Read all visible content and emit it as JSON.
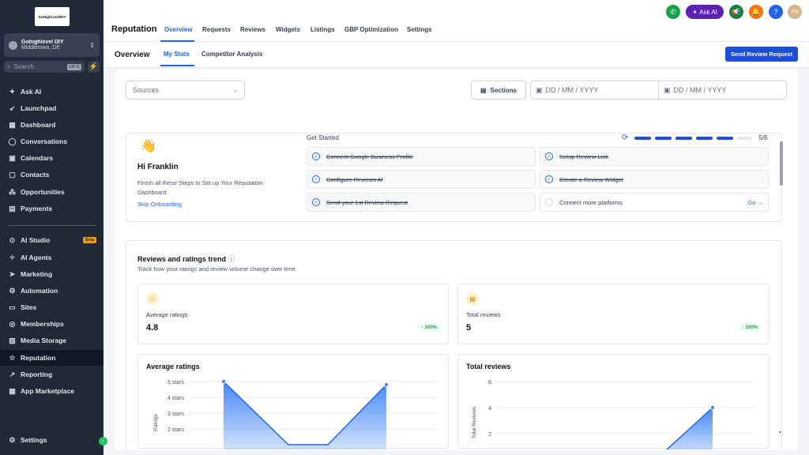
{
  "sidebar": {
    "logo_text": "GoHighLevelDIY",
    "account": {
      "name": "Gohighlevel DIY",
      "location": "Middletown, DE"
    },
    "search": {
      "placeholder": "Search",
      "shortcut": "ctrl K"
    },
    "items": [
      {
        "label": "Ask AI",
        "icon": "sparkle-icon"
      },
      {
        "label": "Launchpad",
        "icon": "rocket-icon"
      },
      {
        "label": "Dashboard",
        "icon": "dashboard-icon"
      },
      {
        "label": "Conversations",
        "icon": "chat-icon"
      },
      {
        "label": "Calendars",
        "icon": "calendar-icon"
      },
      {
        "label": "Contacts",
        "icon": "contacts-icon"
      },
      {
        "label": "Opportunities",
        "icon": "opportunities-icon"
      },
      {
        "label": "Payments",
        "icon": "payments-icon"
      },
      {
        "label": "AI Studio",
        "icon": "ai-studio-icon",
        "badge": "Beta"
      },
      {
        "label": "AI Agents",
        "icon": "ai-agents-icon"
      },
      {
        "label": "Marketing",
        "icon": "marketing-icon"
      },
      {
        "label": "Automation",
        "icon": "automation-icon"
      },
      {
        "label": "Sites",
        "icon": "sites-icon"
      },
      {
        "label": "Memberships",
        "icon": "memberships-icon"
      },
      {
        "label": "Media Storage",
        "icon": "media-icon"
      },
      {
        "label": "Reputation",
        "icon": "star-icon"
      },
      {
        "label": "Reporting",
        "icon": "reporting-icon"
      },
      {
        "label": "App Marketplace",
        "icon": "apps-icon"
      }
    ],
    "settings": "Settings"
  },
  "header": {
    "title": "Reputation",
    "tabs": [
      "Overview",
      "Requests",
      "Reviews",
      "Widgets",
      "Listings",
      "GBP Optimization",
      "Settings"
    ],
    "ask_ai": "Ask AI",
    "avatar": "FN"
  },
  "subheader": {
    "title": "Overview",
    "tabs": [
      "My Stats",
      "Competitor Analysis"
    ],
    "send_button": "Send Review Request"
  },
  "filters": {
    "sources": "Sources",
    "sections": "Sections",
    "date_from": "DD / MM / YYYY",
    "date_to": "DD / MM / YYYY"
  },
  "onboarding": {
    "greeting": "Hi Franklin",
    "description": "Finish all these Steps to Set up Your Reputation Dashboard",
    "skip": "Skip Onboarding",
    "get_started": "Get Started",
    "progress": "5/6",
    "steps": [
      {
        "label": "Connect Google Business Profile",
        "done": true
      },
      {
        "label": "Setup Review Link",
        "done": true
      },
      {
        "label": "Configure Reviews AI",
        "done": true
      },
      {
        "label": "Create a Review Widget",
        "done": true
      },
      {
        "label": "Send your 1st Review Request",
        "done": true
      },
      {
        "label": "Connect more platforms",
        "done": false,
        "action": "Go"
      }
    ]
  },
  "trend": {
    "title": "Reviews and ratings trend",
    "description": "Track how your ratings and review volume change over time.",
    "cards": [
      {
        "label": "Average ratings",
        "value": "4.8",
        "change": "100%"
      },
      {
        "label": "Total reviews",
        "value": "5",
        "change": "100%"
      }
    ]
  },
  "chart_data": [
    {
      "type": "area",
      "title": "Average ratings",
      "ylabel": "Ratings",
      "yticks": [
        "5 stars",
        "4 stars",
        "3 stars",
        "2 stars"
      ],
      "ylim": [
        2,
        5
      ],
      "series": [
        {
          "values": [
            5,
            1,
            1,
            4.8
          ]
        }
      ]
    },
    {
      "type": "area",
      "title": "Total reviews",
      "ylabel": "Total Reviews",
      "yticks": [
        "6",
        "4",
        "2"
      ],
      "ylim": [
        2,
        6
      ],
      "series": [
        {
          "values": [
            0,
            4
          ]
        }
      ]
    }
  ],
  "colors": {
    "accent": "#2563eb",
    "sidebar": "#1f2937",
    "success": "#16a34a"
  }
}
